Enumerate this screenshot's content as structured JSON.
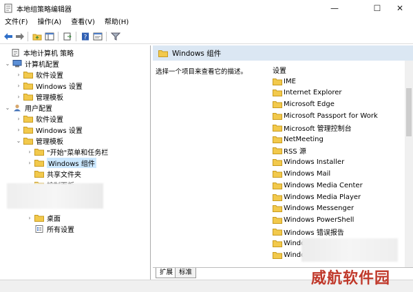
{
  "window": {
    "title": "本地组策略编辑器",
    "controls": {
      "minimize": "—",
      "maximize": "☐",
      "close": "✕"
    }
  },
  "menu": [
    "文件(F)",
    "操作(A)",
    "查看(V)",
    "帮助(H)"
  ],
  "toolbar": [
    "back-arrow-icon",
    "forward-arrow-icon",
    "folder-up-icon",
    "console-tree-icon",
    "export-icon",
    "help-icon",
    "properties-icon",
    "filter-icon"
  ],
  "tree": [
    {
      "label": "本地计算机 策略",
      "icon": "policy-icon",
      "level": 0,
      "expander": ""
    },
    {
      "label": "计算机配置",
      "icon": "computer-icon",
      "level": 1,
      "expander": "⌄"
    },
    {
      "label": "软件设置",
      "icon": "folder-icon",
      "level": 2,
      "expander": "›"
    },
    {
      "label": "Windows 设置",
      "icon": "folder-icon",
      "level": 2,
      "expander": "›"
    },
    {
      "label": "管理模板",
      "icon": "folder-icon",
      "level": 2,
      "expander": "›"
    },
    {
      "label": "用户配置",
      "icon": "user-icon",
      "level": 1,
      "expander": "⌄"
    },
    {
      "label": "软件设置",
      "icon": "folder-icon",
      "level": 2,
      "expander": "›"
    },
    {
      "label": "Windows 设置",
      "icon": "folder-icon",
      "level": 2,
      "expander": "›"
    },
    {
      "label": "管理模板",
      "icon": "folder-icon",
      "level": 2,
      "expander": "⌄"
    },
    {
      "label": "\"开始\"菜单和任务栏",
      "icon": "folder-icon",
      "level": 3,
      "expander": "›"
    },
    {
      "label": "Windows 组件",
      "icon": "folder-icon",
      "level": 3,
      "expander": "›",
      "selected": true
    },
    {
      "label": "共享文件夹",
      "icon": "folder-icon",
      "level": 3,
      "expander": ""
    },
    {
      "label": "控制面板",
      "icon": "folder-icon",
      "level": 3,
      "expander": "›"
    },
    {
      "label": "",
      "icon": "",
      "level": 3,
      "expander": ""
    },
    {
      "label": "",
      "icon": "",
      "level": 3,
      "expander": ""
    },
    {
      "label": "桌面",
      "icon": "folder-icon",
      "level": 3,
      "expander": "›"
    },
    {
      "label": "所有设置",
      "icon": "settings-icon",
      "level": 3,
      "expander": ""
    }
  ],
  "details": {
    "header": "Windows 组件",
    "description": "选择一个项目来查看它的描述。",
    "column_header": "设置",
    "items": [
      "IME",
      "Internet Explorer",
      "Microsoft Edge",
      "Microsoft Passport for Work",
      "Microsoft 管理控制台",
      "NetMeeting",
      "RSS 源",
      "Windows Installer",
      "Windows Mail",
      "Windows Media Center",
      "Windows Media Player",
      "Windows Messenger",
      "Windows PowerShell",
      "Windows 错误报告",
      "Windo",
      "Windo"
    ]
  },
  "tabs": [
    "扩展",
    "标准"
  ],
  "watermark": "威航软件园",
  "colors": {
    "header_bg": "#dbe7f3",
    "selected_bg": "#cce8ff",
    "folder": "#f2c94c",
    "watermark": "#c0392b"
  }
}
